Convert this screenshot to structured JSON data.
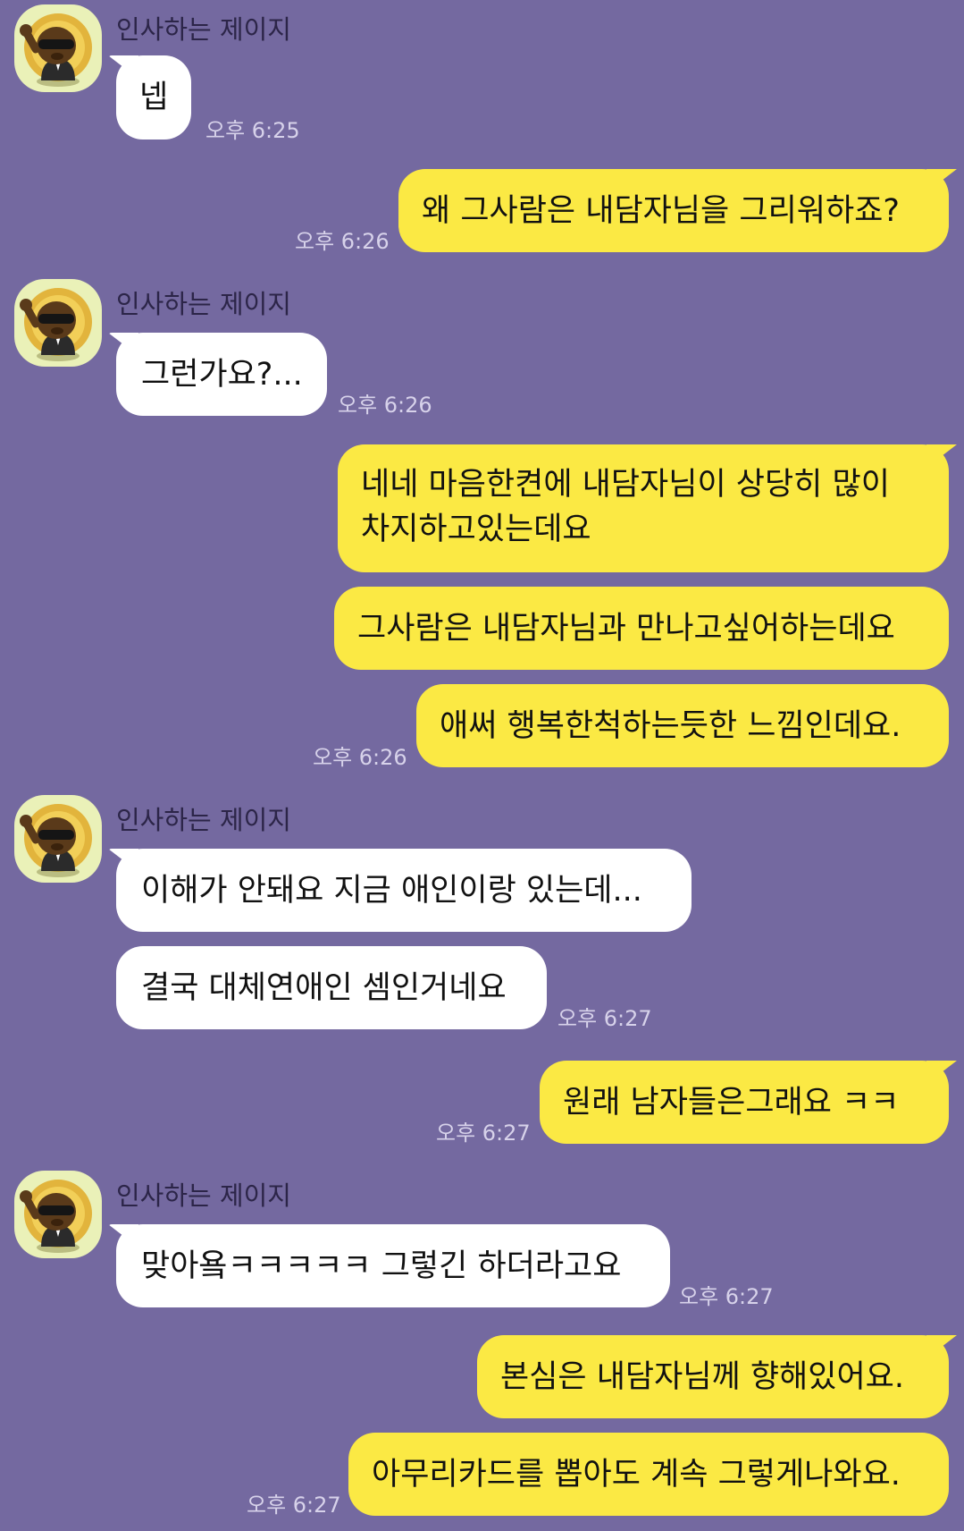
{
  "sender_name": "인사하는 제이지",
  "messages": [
    {
      "text": "넵",
      "time": "오후 6:25"
    },
    {
      "text": "왜 그사람은 내담자님을 그리워하죠?",
      "time": "오후 6:26"
    },
    {
      "text": "그런가요?...",
      "time": "오후 6:26"
    },
    {
      "text": "네네 마음한켠에 내담자님이 상당히 많이 차지하고있는데요"
    },
    {
      "text": "그사람은 내담자님과 만나고싶어하는데요"
    },
    {
      "text": "애써 행복한척하는듯한 느낌인데요.",
      "time": "오후 6:26"
    },
    {
      "text": "이해가 안돼요 지금 애인이랑 있는데..."
    },
    {
      "text": "결국 대체연애인 셈인거네요",
      "time": "오후 6:27"
    },
    {
      "text": "원래 남자들은그래요 ㅋㅋ",
      "time": "오후 6:27"
    },
    {
      "text": "맞아욬ㅋㅋㅋㅋㅋ 그렇긴 하더라고요",
      "time": "오후 6:27"
    },
    {
      "text": "본심은 내담자님께 향해있어요."
    },
    {
      "text": "아무리카드를 뽑아도 계속 그렇게나와요.",
      "time": "오후 6:27"
    }
  ],
  "colors": {
    "background": "#7469a0",
    "incoming_bubble": "#ffffff",
    "outgoing_bubble": "#fbe944",
    "avatar_bg": "#eaf1b8"
  },
  "icons": {
    "avatar": "character-avatar-icon"
  }
}
